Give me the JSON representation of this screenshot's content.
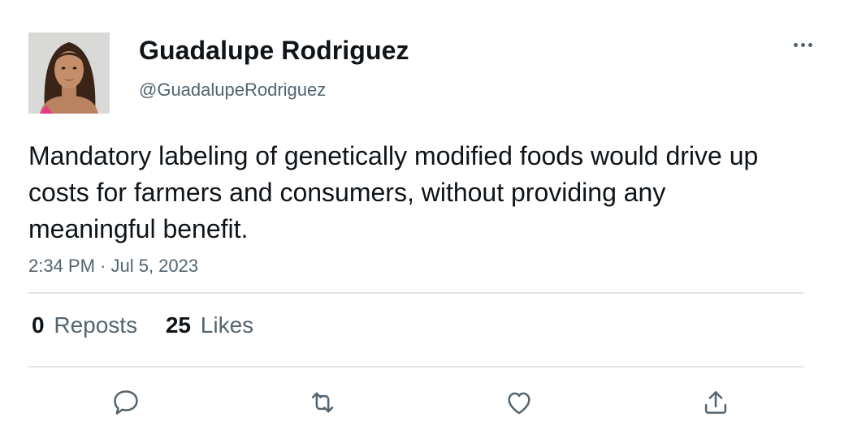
{
  "author": {
    "name": "Guadalupe Rodriguez",
    "handle": "@GuadalupeRodriguez",
    "avatar_icon": "profile-photo"
  },
  "tweet": {
    "text": "Mandatory labeling of genetically modified foods would drive up costs for farmers and consumers, without providing any meaningful benefit.",
    "timestamp": "2:34 PM · Jul 5, 2023"
  },
  "stats": {
    "reposts_count": "0",
    "reposts_label": "Reposts",
    "likes_count": "25",
    "likes_label": "Likes"
  },
  "actions": [
    {
      "name": "reply",
      "icon": "speech-bubble-icon"
    },
    {
      "name": "repost",
      "icon": "repost-arrows-icon"
    },
    {
      "name": "like",
      "icon": "heart-icon"
    },
    {
      "name": "share",
      "icon": "share-upload-icon"
    }
  ],
  "menu": {
    "icon": "more-horizontal-icon"
  },
  "colors": {
    "text_primary": "#0f1419",
    "text_secondary": "#536471",
    "divider": "#e1e5e8",
    "accent_shirt": "#e8388a"
  }
}
